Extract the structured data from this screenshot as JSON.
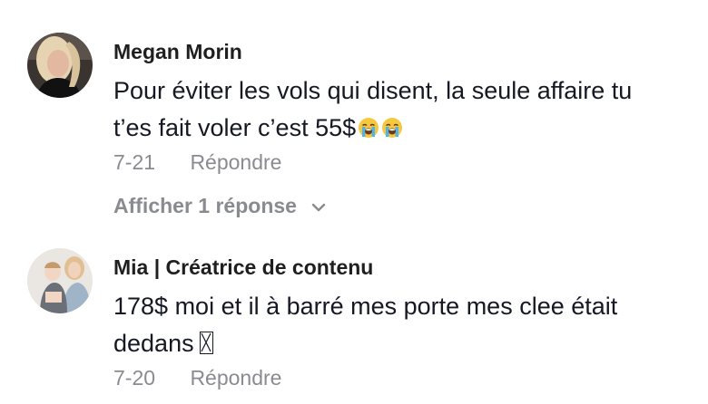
{
  "comments": [
    {
      "author": "Megan Morin",
      "text_line1": "Pour éviter les vols qui disent, la seule affaire tu",
      "text_line2": "t’es fait voler c’est 55$",
      "emojis": [
        "loudly-crying-face-icon",
        "loudly-crying-face-icon"
      ],
      "date": "7-21",
      "reply_label": "Répondre",
      "view_replies_label": "Afficher 1 réponse"
    },
    {
      "author": "Mia | Créatrice de contenu",
      "text_line1": "178$ moi et il à barré mes porte mes clee était",
      "text_line2": "dedans",
      "date": "7-20",
      "reply_label": "Répondre"
    }
  ],
  "colors": {
    "author": "#1f1f1f",
    "text": "#161823",
    "muted": "#8a8b91"
  }
}
